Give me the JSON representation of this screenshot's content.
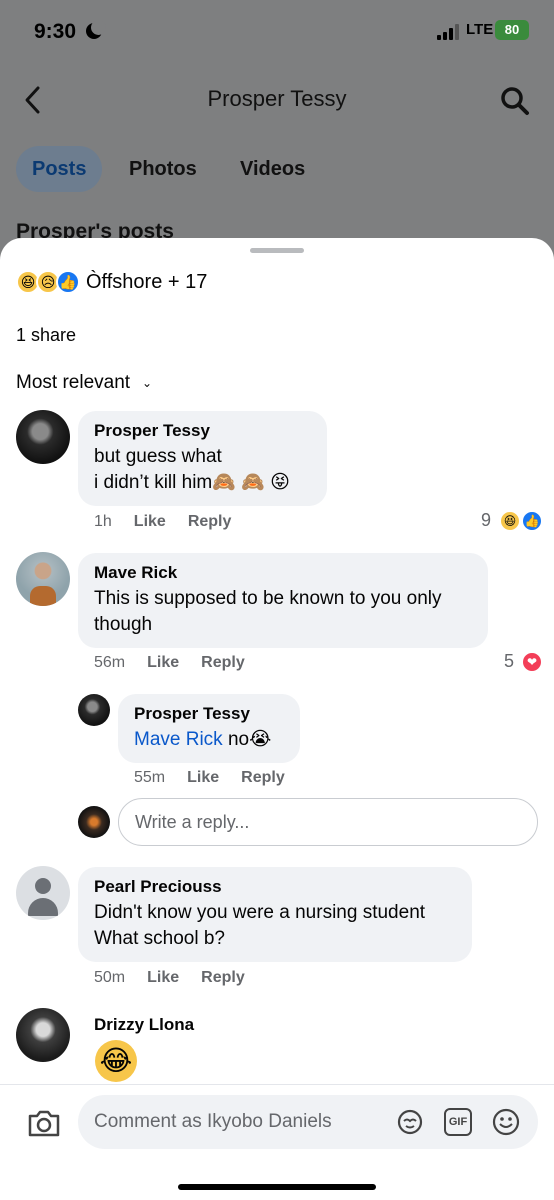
{
  "status_bar": {
    "time": "9:30",
    "network": "LTE",
    "battery": "80"
  },
  "header": {
    "title": "Prosper Tessy"
  },
  "tabs": [
    {
      "label": "Posts",
      "active": true
    },
    {
      "label": "Photos",
      "active": false
    },
    {
      "label": "Videos",
      "active": false
    }
  ],
  "section_peek": "Prosper's posts",
  "sheet": {
    "reactions": {
      "emojis": [
        "😆",
        "😥",
        "👍"
      ],
      "text": "Òffshore + 17"
    },
    "share_count": "1 share",
    "sort_label": "Most relevant"
  },
  "comments": [
    {
      "author": "Prosper Tessy",
      "body": "but guess what\ni didn’t kill him🙈 🙈 😝",
      "time": "1h",
      "like": "Like",
      "reply": "Reply",
      "reaction_count": "9",
      "reaction_icons": [
        "😆",
        "👍"
      ]
    },
    {
      "author": "Mave Rick",
      "body": "This is supposed to be known to you only\nthough",
      "time": "56m",
      "like": "Like",
      "reply": "Reply",
      "reaction_count": "5",
      "reaction_icons": [
        "❤"
      ]
    },
    {
      "author": "Prosper Tessy",
      "mention": "Mave Rick",
      "body": " no😭",
      "time": "55m",
      "like": "Like",
      "reply": "Reply"
    },
    {
      "author": "Pearl Preciouss",
      "body": "Didn't know you were a nursing student\nWhat school b?",
      "time": "50m",
      "like": "Like",
      "reply": "Reply"
    },
    {
      "author": "Drizzy Llona",
      "body": "😂"
    }
  ],
  "reply_input": {
    "placeholder": "Write a reply..."
  },
  "composer": {
    "placeholder": "Comment as Ikyobo Daniels",
    "gif_label": "GIF"
  },
  "colors": {
    "accent": "#1877f2",
    "bubble": "#f0f2f5",
    "meta": "#65676b"
  }
}
